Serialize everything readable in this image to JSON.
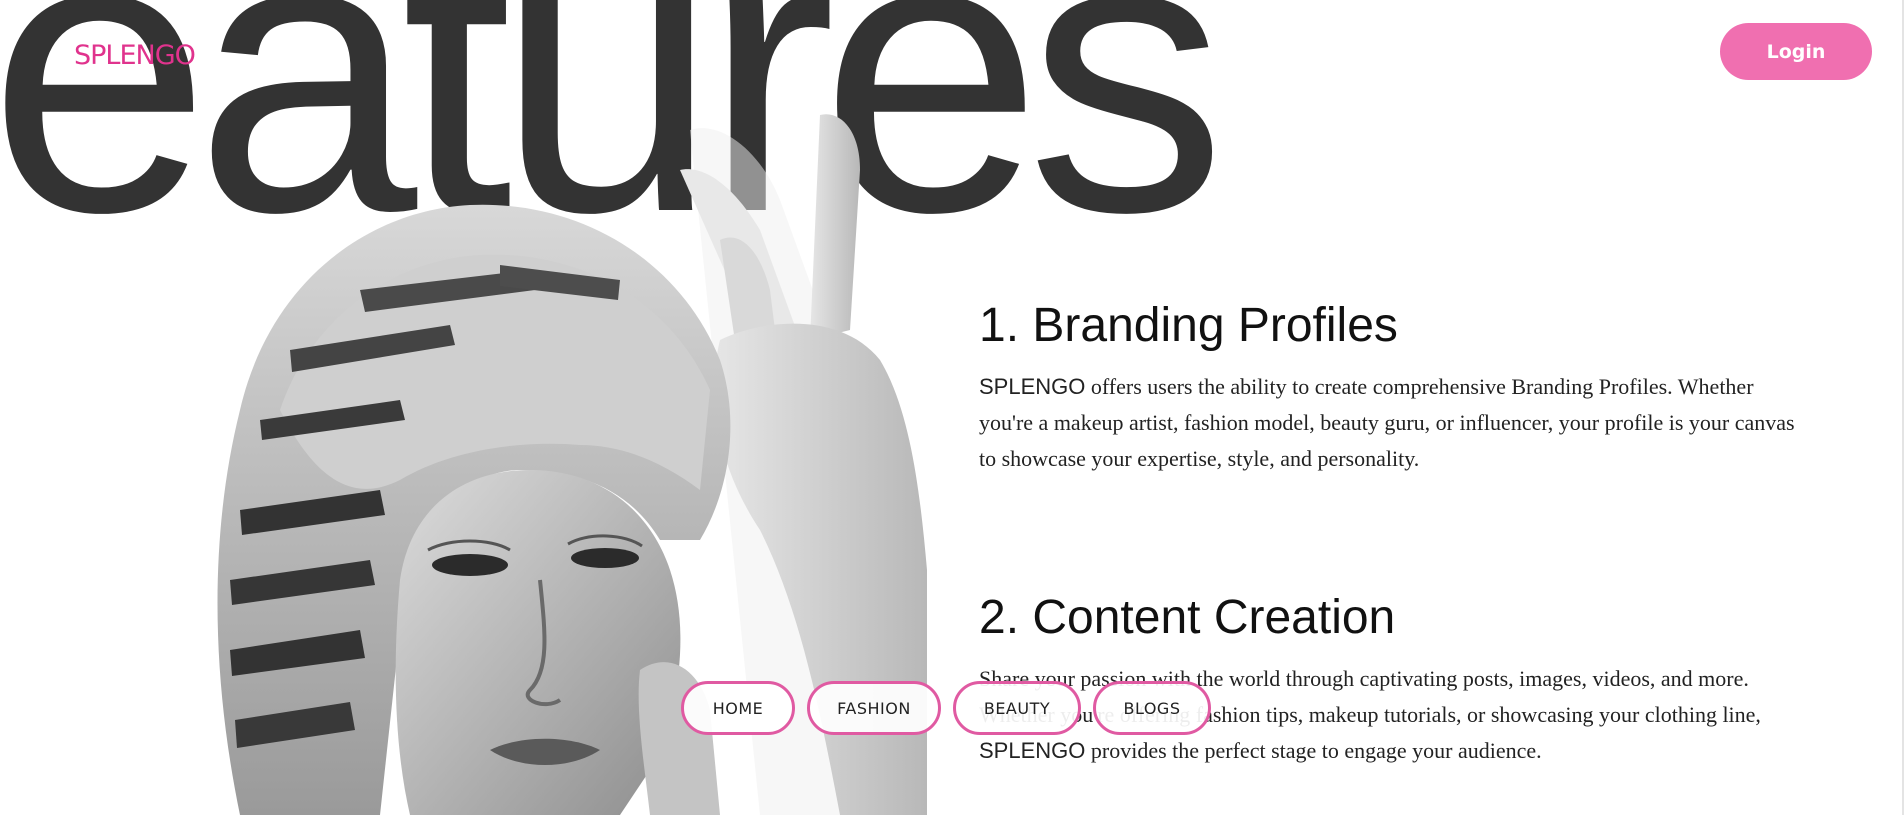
{
  "brand": {
    "logo_text": "SPLENGO",
    "accent_color": "#e0338d",
    "button_color": "#f06fb0"
  },
  "header": {
    "background_heading": "Features",
    "login_label": "Login"
  },
  "hero_image": {
    "alt": "grayscale portrait photo"
  },
  "features": [
    {
      "title": "1. Branding Profiles",
      "body_brand": "SPLENGO",
      "body": " offers users the ability to create comprehensive Branding Profiles. Whether you're a makeup artist, fashion model, beauty guru, or influencer, your profile is your canvas to showcase your expertise, style, and personality."
    },
    {
      "title": "2. Content Creation",
      "body_before": "Share your passion with the world through captivating posts, images, videos, and more. Whether you're offering fashion tips, makeup tutorials, or showcasing your clothing line, ",
      "body_brand": "SPLENGO",
      "body_after": " provides the perfect stage to engage your audience."
    }
  ],
  "nav": {
    "items": [
      {
        "label": "HOME"
      },
      {
        "label": "FASHION"
      },
      {
        "label": "BEAUTY"
      },
      {
        "label": "BLOGS"
      }
    ]
  }
}
